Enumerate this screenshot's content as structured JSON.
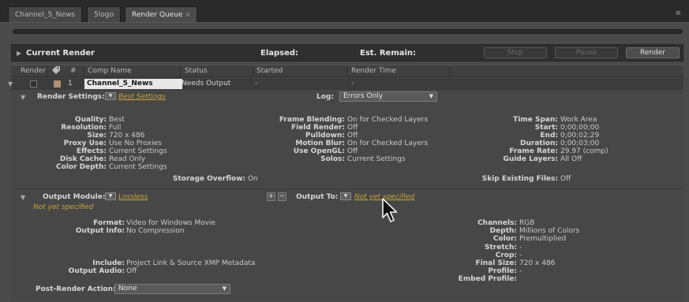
{
  "tabs": [
    {
      "label": "Channel_5_News"
    },
    {
      "label": "5logo"
    },
    {
      "label": "Render Queue",
      "close": "×"
    }
  ],
  "panel_menu_icon": "≡",
  "current_render": {
    "title": "Current Render",
    "elapsed_label": "Elapsed:",
    "remain_label": "Est. Remain:",
    "buttons": {
      "stop": "Stop",
      "pause": "Pause",
      "render": "Render"
    }
  },
  "columns": {
    "render": "Render",
    "tag_icon": "label-tag-icon",
    "number": "#",
    "comp_name": "Comp Name",
    "status": "Status",
    "started": "Started",
    "render_time": "Render Time"
  },
  "item": {
    "number": "1",
    "comp_name": "Channel_5_News",
    "status": "Needs Output",
    "started": "-",
    "render_time": "-"
  },
  "render_settings": {
    "label": "Render Settings:",
    "preset": "Best Settings",
    "log_label": "Log:",
    "log_value": "Errors Only",
    "col1": [
      {
        "label": "Quality:",
        "value": "Best"
      },
      {
        "label": "Resolution:",
        "value": "Full"
      },
      {
        "label": "Size:",
        "value": "720 x 486"
      },
      {
        "label": "Proxy Use:",
        "value": "Use No Proxies"
      },
      {
        "label": "Effects:",
        "value": "Current Settings"
      },
      {
        "label": "Disk Cache:",
        "value": "Read Only"
      },
      {
        "label": "Color Depth:",
        "value": "Current Settings"
      }
    ],
    "col2": [
      {
        "label": "Frame Blending:",
        "value": "On for Checked Layers"
      },
      {
        "label": "Field Render:",
        "value": "Off"
      },
      {
        "label": "Pulldown:",
        "value": "Off"
      },
      {
        "label": "Motion Blur:",
        "value": "On for Checked Layers"
      },
      {
        "label": "Use OpenGL:",
        "value": "Off"
      },
      {
        "label": "Solos:",
        "value": "Current Settings"
      }
    ],
    "col3": [
      {
        "label": "Time Span:",
        "value": "Work Area"
      },
      {
        "label": "Start:",
        "value": "0;00;00;00"
      },
      {
        "label": "End:",
        "value": "0;00;02;29"
      },
      {
        "label": "Duration:",
        "value": "0;00;03;00"
      },
      {
        "label": "Frame Rate:",
        "value": "29.97 (comp)"
      },
      {
        "label": "Guide Layers:",
        "value": "All Off"
      }
    ],
    "storage_overflow_label": "Storage Overflow:",
    "storage_overflow_value": "On",
    "skip_existing_label": "Skip Existing Files:",
    "skip_existing_value": "Off"
  },
  "output_module": {
    "label": "Output Module:",
    "preset": "Lossless",
    "not_specified": "Not yet specified",
    "plus": "+",
    "minus": "−",
    "output_to_label": "Output To:",
    "output_to_value": "Not yet specified",
    "format_label": "Format:",
    "format_value": "Video for Windows Movie",
    "output_info_label": "Output Info:",
    "output_info_value": "No Compression",
    "include_label": "Include:",
    "include_value": "Project Link & Source XMP Metadata",
    "output_audio_label": "Output Audio:",
    "output_audio_value": "Off",
    "right": [
      {
        "label": "Channels:",
        "value": "RGB"
      },
      {
        "label": "Depth:",
        "value": "Millions of Colors"
      },
      {
        "label": "Color:",
        "value": "Premultiplied"
      },
      {
        "label": "Stretch:",
        "value": "-"
      },
      {
        "label": "Crop:",
        "value": "-"
      },
      {
        "label": "Final Size:",
        "value": "720 x 486"
      },
      {
        "label": "Profile:",
        "value": "-"
      },
      {
        "label": "Embed Profile:",
        "value": ""
      }
    ]
  },
  "post_render": {
    "label": "Post-Render Action:",
    "value": "None"
  }
}
